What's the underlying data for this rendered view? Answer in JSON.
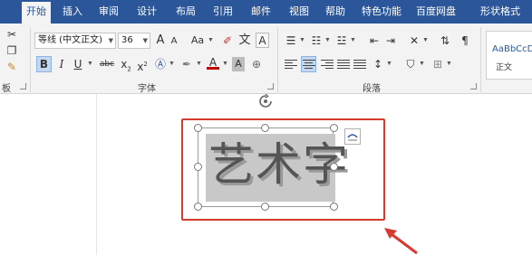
{
  "tabs": [
    {
      "label": "开始",
      "active": true
    },
    {
      "label": "插入",
      "active": false
    },
    {
      "label": "审阅",
      "active": false
    },
    {
      "label": "设计",
      "active": false
    },
    {
      "label": "布局",
      "active": false
    },
    {
      "label": "引用",
      "active": false
    },
    {
      "label": "邮件",
      "active": false
    },
    {
      "label": "视图",
      "active": false
    },
    {
      "label": "帮助",
      "active": false
    },
    {
      "label": "特色功能",
      "active": false
    },
    {
      "label": "百度网盘",
      "active": false
    },
    {
      "label": "形状格式",
      "active": false
    }
  ],
  "font_group": {
    "font_name": "等线 (中文正文)",
    "font_size": "36",
    "grow_label": "A",
    "shrink_label": "A",
    "case_label": "Aa",
    "phonetic_label": "文",
    "border_label": "A",
    "bold": "B",
    "italic": "I",
    "underline": "U",
    "strike": "abc",
    "subscript": "x",
    "superscript": "x",
    "font_color_label": "A",
    "shade_label": "A",
    "label": "字体"
  },
  "paragraph_group": {
    "label": "段落"
  },
  "clipboard_group": {
    "label": "板"
  },
  "styles": {
    "sample": "AaBbCcD",
    "name": "正文"
  },
  "document": {
    "wordart_text": "艺术字"
  },
  "colors": {
    "accent": "#2b579a",
    "highlight": "#d63b2f"
  }
}
